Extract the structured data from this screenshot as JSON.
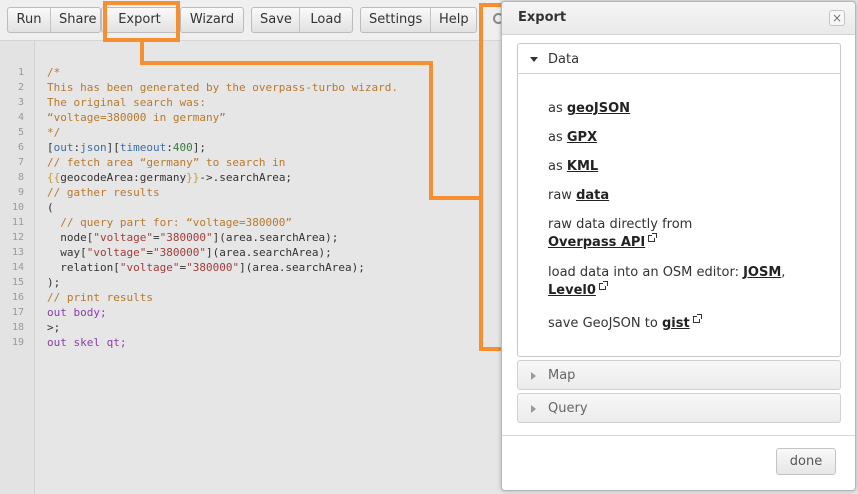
{
  "toolbar": {
    "run": "Run",
    "share": "Share",
    "export": "Export",
    "wizard": "Wizard",
    "save": "Save",
    "load": "Load",
    "settings": "Settings",
    "help": "Help"
  },
  "editor": {
    "line_numbers": [
      "1",
      "2",
      "3",
      "4",
      "5",
      "6",
      "7",
      "8",
      "9",
      "10",
      "11",
      "12",
      "13",
      "14",
      "15",
      "16",
      "17",
      "18",
      "19"
    ],
    "lines": [
      [
        {
          "t": "/*",
          "c": "comment"
        }
      ],
      [
        {
          "t": "This has been generated by the overpass-turbo wizard.",
          "c": "comment"
        }
      ],
      [
        {
          "t": "The original search was:",
          "c": "comment"
        }
      ],
      [
        {
          "t": "“voltage=380000 in germany”",
          "c": "comment"
        }
      ],
      [
        {
          "t": "*/",
          "c": "comment"
        }
      ],
      [
        {
          "t": "[",
          "c": "plain"
        },
        {
          "t": "out",
          "c": "key"
        },
        {
          "t": ":",
          "c": "plain"
        },
        {
          "t": "json",
          "c": "key"
        },
        {
          "t": "][",
          "c": "plain"
        },
        {
          "t": "timeout",
          "c": "key"
        },
        {
          "t": ":",
          "c": "plain"
        },
        {
          "t": "400",
          "c": "num"
        },
        {
          "t": "];",
          "c": "plain"
        }
      ],
      [
        {
          "t": "// fetch area “germany” to search in",
          "c": "comment"
        }
      ],
      [
        {
          "t": "{{",
          "c": "brace"
        },
        {
          "t": "geocodeArea:germany",
          "c": "plain"
        },
        {
          "t": "}}",
          "c": "brace"
        },
        {
          "t": "->.searchArea;",
          "c": "plain"
        }
      ],
      [
        {
          "t": "// gather results",
          "c": "comment"
        }
      ],
      [
        {
          "t": "(",
          "c": "plain"
        }
      ],
      [
        {
          "t": "  // query part for: “voltage=380000”",
          "c": "comment"
        }
      ],
      [
        {
          "t": "  node",
          "c": "plain"
        },
        {
          "t": "[",
          "c": "plain"
        },
        {
          "t": "\"voltage\"",
          "c": "str"
        },
        {
          "t": "=",
          "c": "plain"
        },
        {
          "t": "\"380000\"",
          "c": "str"
        },
        {
          "t": "](area.searchArea);",
          "c": "plain"
        }
      ],
      [
        {
          "t": "  way",
          "c": "plain"
        },
        {
          "t": "[",
          "c": "plain"
        },
        {
          "t": "\"voltage\"",
          "c": "str"
        },
        {
          "t": "=",
          "c": "plain"
        },
        {
          "t": "\"380000\"",
          "c": "str"
        },
        {
          "t": "](area.searchArea);",
          "c": "plain"
        }
      ],
      [
        {
          "t": "  relation",
          "c": "plain"
        },
        {
          "t": "[",
          "c": "plain"
        },
        {
          "t": "\"voltage\"",
          "c": "str"
        },
        {
          "t": "=",
          "c": "plain"
        },
        {
          "t": "\"380000\"",
          "c": "str"
        },
        {
          "t": "](area.searchArea);",
          "c": "plain"
        }
      ],
      [
        {
          "t": ");",
          "c": "plain"
        }
      ],
      [
        {
          "t": "// print results",
          "c": "comment"
        }
      ],
      [
        {
          "t": "out body;",
          "c": "kw"
        }
      ],
      [
        {
          "t": ">;",
          "c": "plain"
        }
      ],
      [
        {
          "t": "out skel qt;",
          "c": "kw"
        }
      ]
    ]
  },
  "dialog": {
    "title": "Export",
    "close": "×",
    "data_section": {
      "label": "Data",
      "geojson_prefix": "as ",
      "geojson_link": "geoJSON",
      "gpx_prefix": "as ",
      "gpx_link": "GPX",
      "kml_prefix": "as ",
      "kml_link": "KML",
      "raw_prefix": "raw ",
      "raw_link": "data",
      "direct_text": "raw data directly from",
      "direct_link": "Overpass API",
      "editor_text": "load data into an OSM editor: ",
      "josm_link": "JOSM",
      "editor_sep": ",",
      "level0_link": "Level0",
      "gist_prefix": "save GeoJSON to ",
      "gist_link": "gist"
    },
    "map_section": {
      "label": "Map"
    },
    "query_section": {
      "label": "Query"
    },
    "done_button": "done"
  },
  "colors": {
    "highlight": "#f58f2f"
  }
}
